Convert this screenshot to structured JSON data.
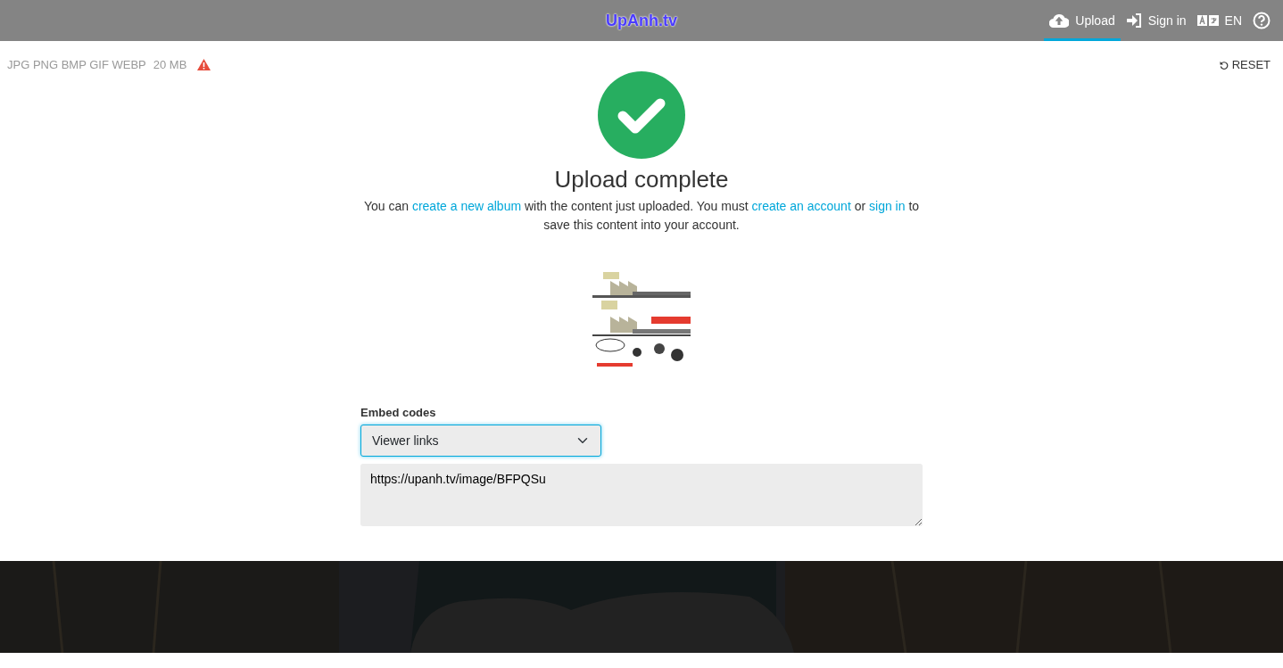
{
  "top_bar": {
    "logo": "UpAnh.tv",
    "items": [
      {
        "kind": "upload",
        "label": "Upload",
        "selected": true
      },
      {
        "kind": "signin",
        "label": "Sign in",
        "selected": false
      },
      {
        "kind": "language",
        "label": "EN",
        "selected": false
      },
      {
        "kind": "help",
        "selected": false
      }
    ]
  },
  "limits": {
    "formats": "JPG PNG BMP GIF WEBP",
    "max_size": "20 MB"
  },
  "reset": "RESET",
  "result": {
    "title": "Upload complete",
    "message": [
      {
        "kind": "text",
        "text": "You can "
      },
      {
        "kind": "link",
        "text": "create a new album"
      },
      {
        "kind": "text",
        "text": " with the content just uploaded. You must "
      },
      {
        "kind": "link",
        "text": "create an account"
      },
      {
        "kind": "text",
        "text": " or "
      },
      {
        "kind": "link",
        "text": "sign in"
      },
      {
        "kind": "text",
        "text": " to save this content into your account."
      }
    ]
  },
  "embed": {
    "label": "Embed codes",
    "selected_option": "Viewer links",
    "code": "https://upanh.tv/image/BFPQSu"
  }
}
